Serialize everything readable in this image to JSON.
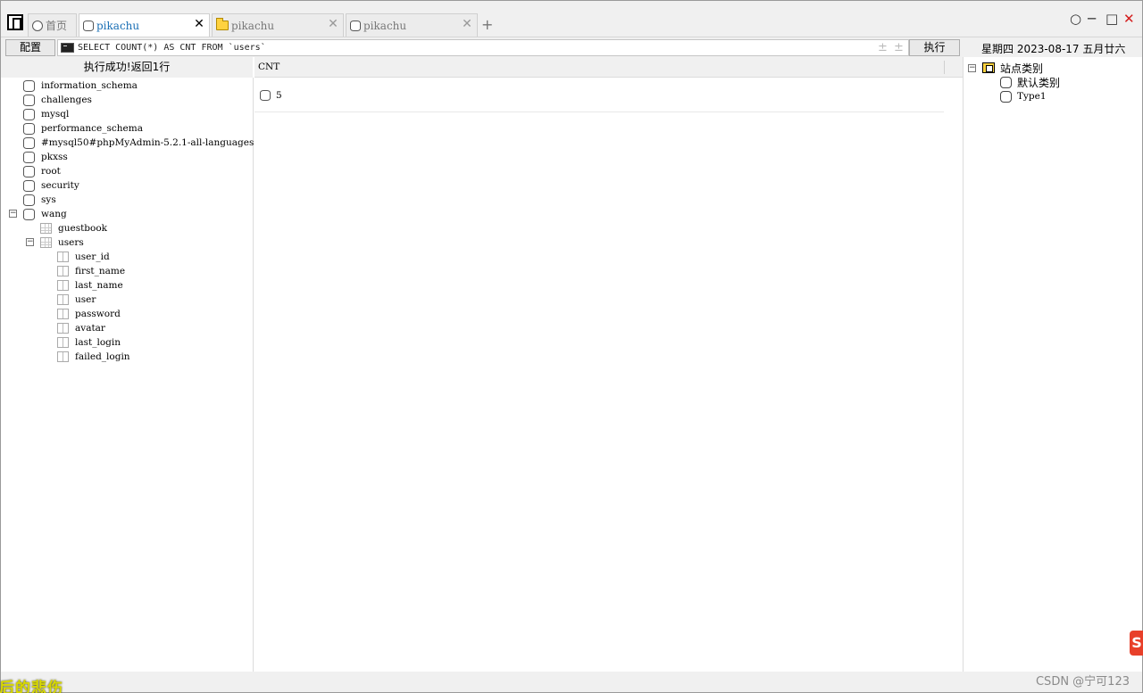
{
  "tabs": [
    {
      "label": "首页",
      "icon": "home-tab-icon"
    },
    {
      "label": "pikachu",
      "icon": "database-icon",
      "active": true
    },
    {
      "label": "pikachu",
      "icon": "folder-icon"
    },
    {
      "label": "pikachu",
      "icon": "database-icon"
    }
  ],
  "toolbar": {
    "config_label": "配置",
    "sql_query": "SELECT COUNT(*) AS CNT FROM `users`",
    "increase_glyph": "±",
    "decrease_glyph": "±",
    "execute_label": "执行",
    "datetime": "星期四 2023-08-17 五月廿六"
  },
  "status": {
    "message": "执行成功!返回1行"
  },
  "tree": {
    "databases": [
      "information_schema",
      "challenges",
      "mysql",
      "performance_schema",
      "#mysql50#phpMyAdmin-5.2.1-all-languages",
      "pkxss",
      "root",
      "security",
      "sys",
      "wang"
    ],
    "expanded_symbol": "−",
    "tables": [
      "guestbook",
      "users"
    ],
    "columns": [
      "user_id",
      "first_name",
      "last_name",
      "user",
      "password",
      "avatar",
      "last_login",
      "failed_login"
    ]
  },
  "results": {
    "column_header": "CNT",
    "rows": [
      {
        "value": "5"
      }
    ]
  },
  "sites": {
    "category_label": "站点类别",
    "items": [
      "默认类别",
      "Type1"
    ]
  },
  "window": {
    "close_glyph": "✕",
    "maximize_glyph": "□",
    "minimize_glyph": "─",
    "circle_glyph": "○"
  },
  "footer": {
    "watermark": "CSDN @宁可123",
    "caption": "后的悲伤",
    "edge_logo": "S"
  },
  "colors": {
    "active_tab_text": "#1a6fb5",
    "close_red": "#d41c1c",
    "background": "#f0f0f0"
  }
}
